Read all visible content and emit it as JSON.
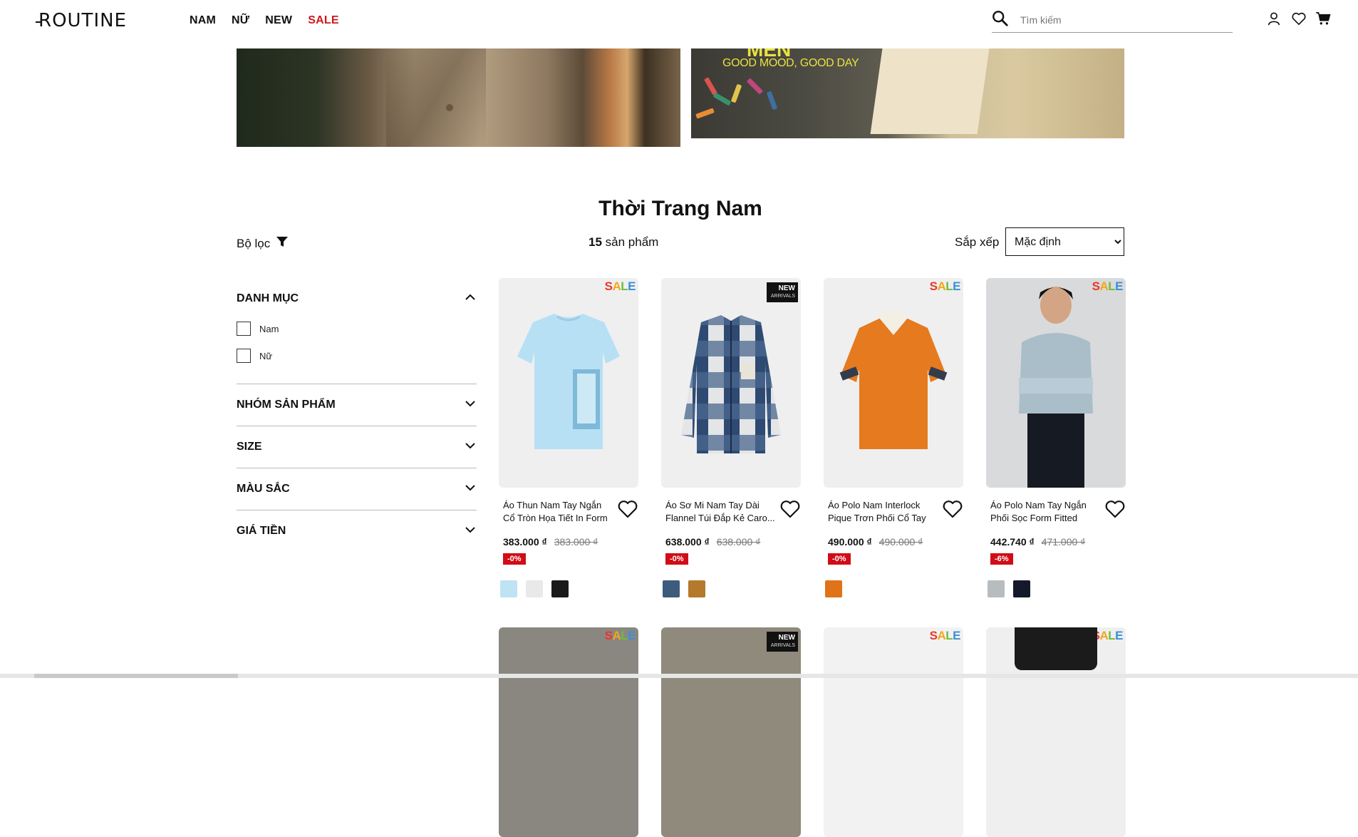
{
  "header": {
    "logo": "ROUTINE",
    "nav": [
      "NAM",
      "NỮ",
      "NEW",
      "SALE"
    ],
    "search_placeholder": "Tìm kiếm",
    "accent": "#d0181b"
  },
  "banner": {
    "tagline": "GOOD MOOD, GOOD DAY",
    "title_partial": "MEN"
  },
  "page": {
    "title": "Thời Trang Nam",
    "filter_label": "Bộ lọc",
    "count_number": "15",
    "count_text": "sản phẩm",
    "sort_label": "Sắp xếp",
    "sort_value": "Mặc định"
  },
  "sidebar": {
    "sections": [
      {
        "title": "DANH MỤC",
        "expanded": true,
        "options": [
          "Nam",
          "Nữ"
        ]
      },
      {
        "title": "NHÓM SẢN PHẨM",
        "expanded": false
      },
      {
        "title": "SIZE",
        "expanded": false
      },
      {
        "title": "MÀU SẮC",
        "expanded": false
      },
      {
        "title": "GIÁ TIỀN",
        "expanded": false
      }
    ]
  },
  "badges": {
    "sale": "SALE",
    "new_line1": "NEW",
    "new_line2": "ARRIVALS"
  },
  "products": [
    {
      "name": "Áo Thun Nam Tay Ngắn Cổ Tròn Họa Tiết In Form Regu",
      "price": "383.000 ₫",
      "old_price": "383.000 ₫",
      "discount": "-0%",
      "badge": "sale",
      "swatches": [
        "#bfe3f3",
        "#e9e9e9",
        "#1a1a1a"
      ]
    },
    {
      "name": "Áo Sơ Mi Nam Tay Dài Flannel Túi Đắp Kẻ Caro...",
      "price": "638.000 ₫",
      "old_price": "638.000 ₫",
      "discount": "-0%",
      "badge": "new",
      "swatches": [
        "#3d5b7d",
        "#b5782c"
      ]
    },
    {
      "name": "Áo Polo Nam Interlock Pique Trơn Phối Cổ Tay Form",
      "price": "490.000 ₫",
      "old_price": "490.000 ₫",
      "discount": "-0%",
      "badge": "sale",
      "swatches": [
        "#e07318"
      ]
    },
    {
      "name": "Áo Polo Nam Tay Ngắn Phối Sọc Form Fitted",
      "price": "442.740 ₫",
      "old_price": "471.000 ₫",
      "discount": "-6%",
      "badge": "sale",
      "swatches": [
        "#b7bcbf",
        "#141a2b"
      ]
    }
  ]
}
